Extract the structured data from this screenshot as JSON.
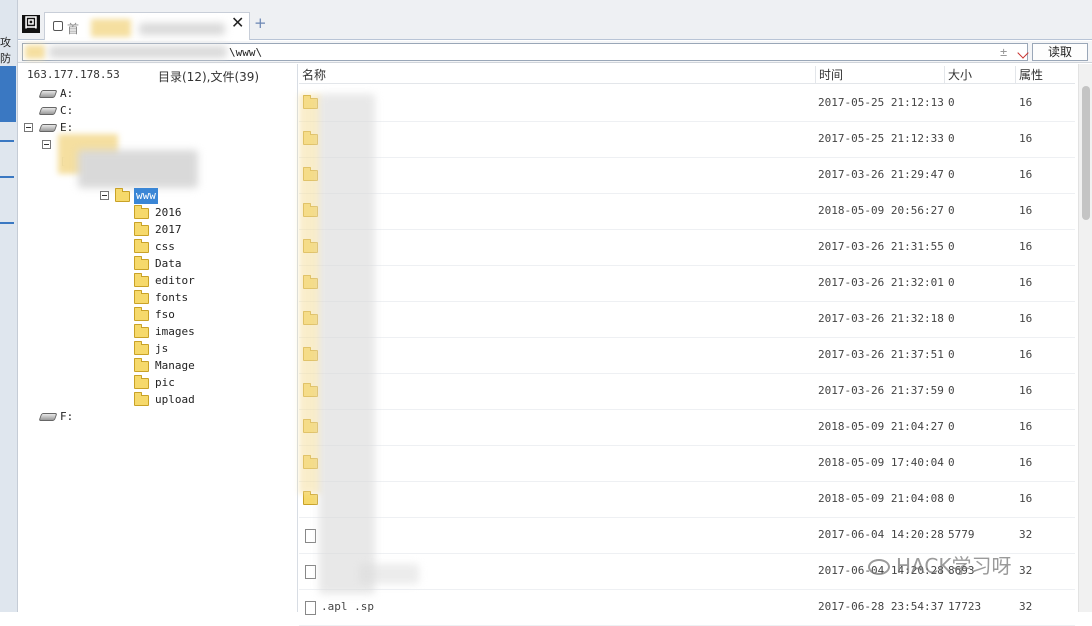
{
  "left_edge": {
    "text": "攻防"
  },
  "tab": {
    "label": "首"
  },
  "address": {
    "value": "\\www\\",
    "plus": "±",
    "read_button": "读取"
  },
  "tree": {
    "ip": "163.177.178.53",
    "count": "目录(12),文件(39)",
    "drives": [
      {
        "label": "A:"
      },
      {
        "label": "C:"
      },
      {
        "label": "E:"
      },
      {
        "label": "F:"
      }
    ],
    "selected": "www",
    "folders": [
      {
        "label": "2016"
      },
      {
        "label": "2017"
      },
      {
        "label": "css"
      },
      {
        "label": "Data"
      },
      {
        "label": "editor"
      },
      {
        "label": "fonts"
      },
      {
        "label": "fso"
      },
      {
        "label": "images"
      },
      {
        "label": "js"
      },
      {
        "label": "Manage"
      },
      {
        "label": "pic"
      },
      {
        "label": "upload"
      }
    ]
  },
  "list": {
    "headers": {
      "name": "名称",
      "time": "时间",
      "size": "大小",
      "attr": "属性"
    },
    "rows": [
      {
        "type": "folder",
        "name": "",
        "time": "2017-05-25 21:12:13",
        "size": "0",
        "attr": "16"
      },
      {
        "type": "folder",
        "name": "",
        "time": "2017-05-25 21:12:33",
        "size": "0",
        "attr": "16"
      },
      {
        "type": "folder",
        "name": "",
        "time": "2017-03-26 21:29:47",
        "size": "0",
        "attr": "16"
      },
      {
        "type": "folder",
        "name": "",
        "time": "2018-05-09 20:56:27",
        "size": "0",
        "attr": "16"
      },
      {
        "type": "folder",
        "name": "",
        "time": "2017-03-26 21:31:55",
        "size": "0",
        "attr": "16"
      },
      {
        "type": "folder",
        "name": "",
        "time": "2017-03-26 21:32:01",
        "size": "0",
        "attr": "16"
      },
      {
        "type": "folder",
        "name": "",
        "time": "2017-03-26 21:32:18",
        "size": "0",
        "attr": "16"
      },
      {
        "type": "folder",
        "name": "",
        "time": "2017-03-26 21:37:51",
        "size": "0",
        "attr": "16"
      },
      {
        "type": "folder",
        "name": "",
        "time": "2017-03-26 21:37:59",
        "size": "0",
        "attr": "16"
      },
      {
        "type": "folder",
        "name": "",
        "time": "2018-05-09 21:04:27",
        "size": "0",
        "attr": "16"
      },
      {
        "type": "folder",
        "name": "",
        "time": "2018-05-09 17:40:04",
        "size": "0",
        "attr": "16"
      },
      {
        "type": "folder",
        "name": "",
        "time": "2018-05-09 21:04:08",
        "size": "0",
        "attr": "16"
      },
      {
        "type": "file",
        "name": "",
        "time": "2017-06-04 14:20:28",
        "size": "5779",
        "attr": "32"
      },
      {
        "type": "file",
        "name": "",
        "time": "2017-06-04 14:20:28",
        "size": "8693",
        "attr": "32"
      },
      {
        "type": "file",
        "name": ".apl   .sp",
        "time": "2017-06-28 23:54:37",
        "size": "17723",
        "attr": "32"
      }
    ]
  },
  "watermark": {
    "text": "HACK学习呀"
  }
}
